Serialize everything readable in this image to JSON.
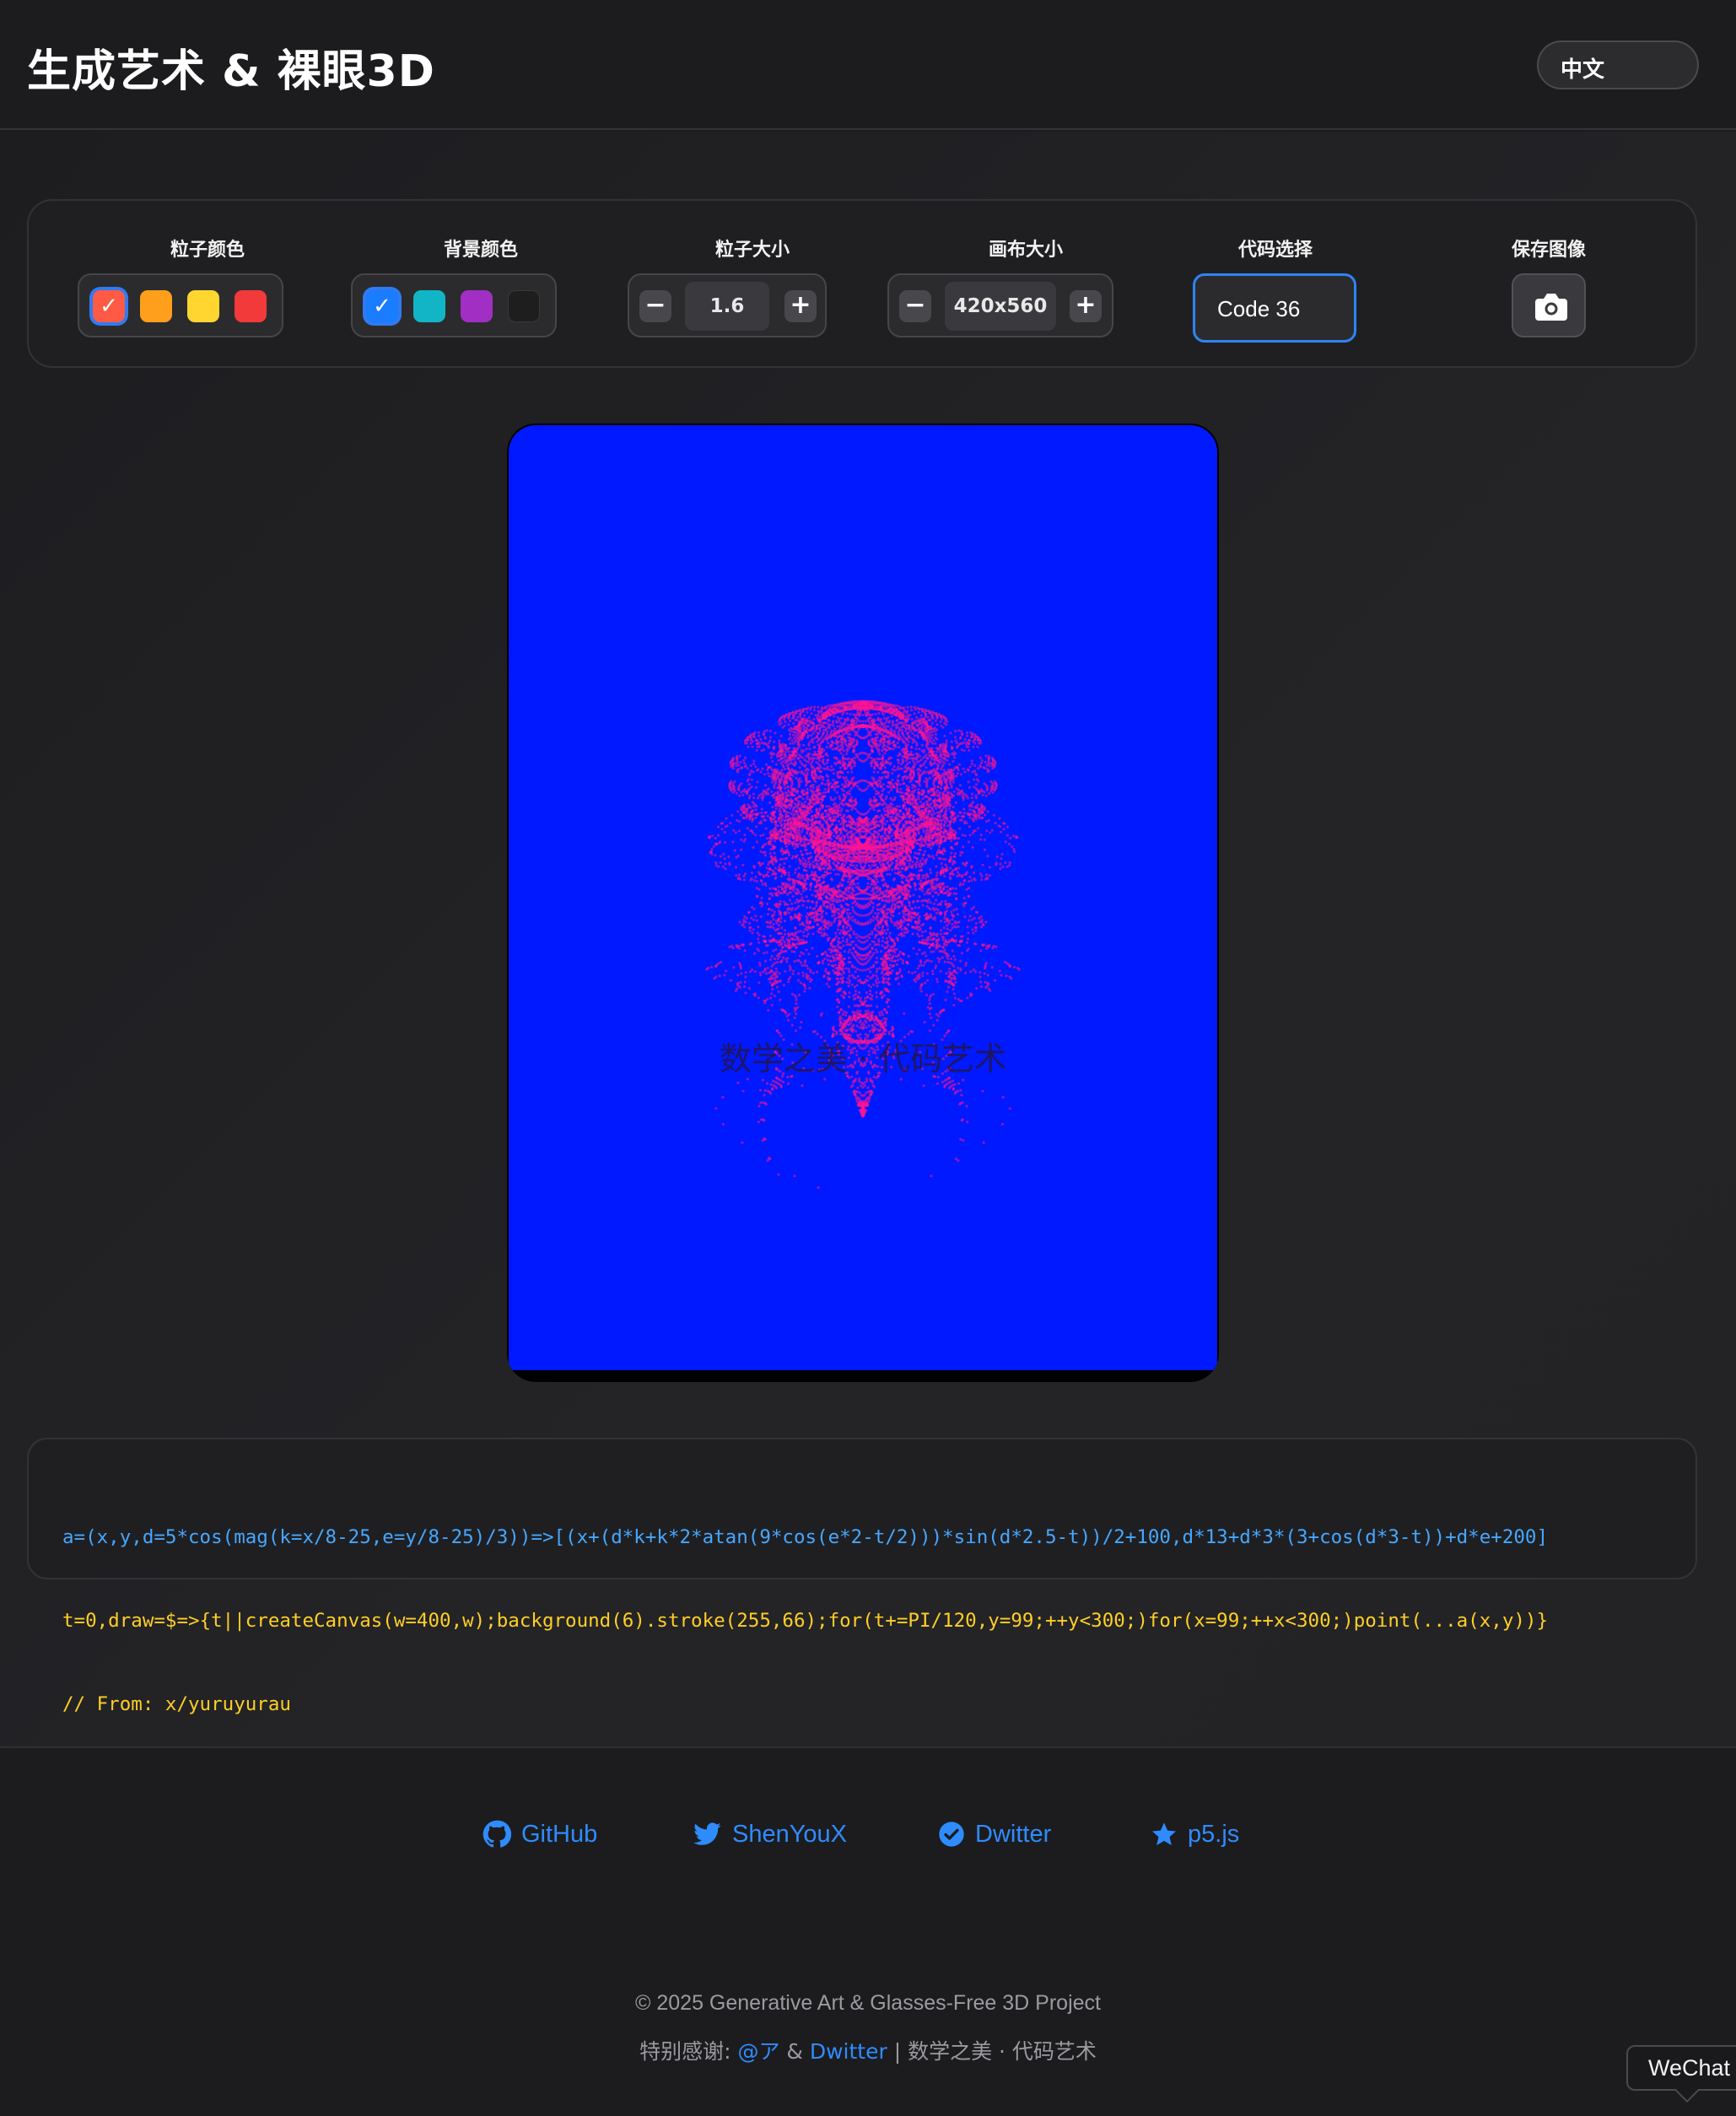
{
  "header": {
    "title": "生成艺术 & 裸眼3D",
    "language": "中文"
  },
  "controls": {
    "particle_color": {
      "label": "粒子颜色",
      "swatches": [
        {
          "color": "#ff5a45",
          "selected": true
        },
        {
          "color": "#ff9f1c",
          "selected": false
        },
        {
          "color": "#ffd530",
          "selected": false
        },
        {
          "color": "#f23a3a",
          "selected": false
        }
      ]
    },
    "background_color": {
      "label": "背景颜色",
      "swatches": [
        {
          "color": "#1a7cff",
          "selected": true
        },
        {
          "color": "#12b5c6",
          "selected": false
        },
        {
          "color": "#a12fc4",
          "selected": false
        },
        {
          "color": "#1e1e1e",
          "selected": false
        }
      ]
    },
    "particle_size": {
      "label": "粒子大小",
      "value": "1.6"
    },
    "canvas_size": {
      "label": "画布大小",
      "value": "420x560"
    },
    "code_select": {
      "label": "代码选择",
      "value": "Code 36"
    },
    "save_image": {
      "label": "保存图像"
    }
  },
  "canvas": {
    "background": "#0019ff",
    "particle_color": "#ff1493",
    "watermark": "数学之美 · 代码艺术"
  },
  "code": {
    "line1": "a=(x,y,d=5*cos(mag(k=x/8-25,e=y/8-25)/3))=>[(x+(d*k+k*2*atan(9*cos(e*2-t/2)))*sin(d*2.5-t))/2+100,d*13+d*3*(3+cos(d*3-t))+d*e+200]",
    "line2": "t=0,draw=$=>{t||createCanvas(w=400,w);background(6).stroke(255,66);for(t+=PI/120,y=99;++y<300;)for(x=99;++x<300;)point(...a(x,y))}",
    "line3": "// From: x/yuruyurau"
  },
  "footer": {
    "links": [
      {
        "label": "GitHub",
        "icon": "github-icon"
      },
      {
        "label": "ShenYouX",
        "icon": "twitter-icon"
      },
      {
        "label": "Dwitter",
        "icon": "verified-icon"
      },
      {
        "label": "p5.js",
        "icon": "star-icon"
      }
    ],
    "copyright": "© 2025 Generative Art & Glasses-Free 3D Project",
    "thanks_prefix": "特别感谢: ",
    "thanks_link1": "@ア",
    "thanks_amp": " & ",
    "thanks_link2": "Dwitter",
    "thanks_suffix": " | 数学之美 · 代码艺术"
  },
  "tooltip": {
    "text": "WeChat"
  },
  "accent_color": "#2f84f2",
  "link_color": "#2f8cff"
}
